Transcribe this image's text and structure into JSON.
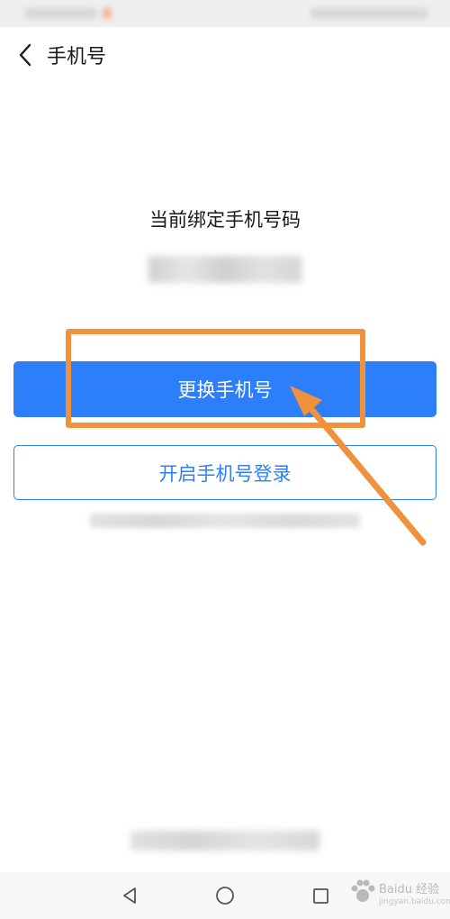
{
  "header": {
    "title": "手机号",
    "back_icon": "chevron-left-icon"
  },
  "main": {
    "subtitle": "当前绑定手机号码",
    "change_phone_button": "更换手机号",
    "enable_phone_login_button": "开启手机号登录"
  },
  "system_nav": {
    "back_icon": "triangle-back-icon",
    "home_icon": "circle-home-icon",
    "recents_icon": "square-recents-icon"
  },
  "watermark": {
    "brand": "Baidu 经验",
    "url": "jingyan.baidu.com"
  },
  "annotation": {
    "highlight_color": "#f0913b",
    "button_color": "#2d7ff9"
  }
}
